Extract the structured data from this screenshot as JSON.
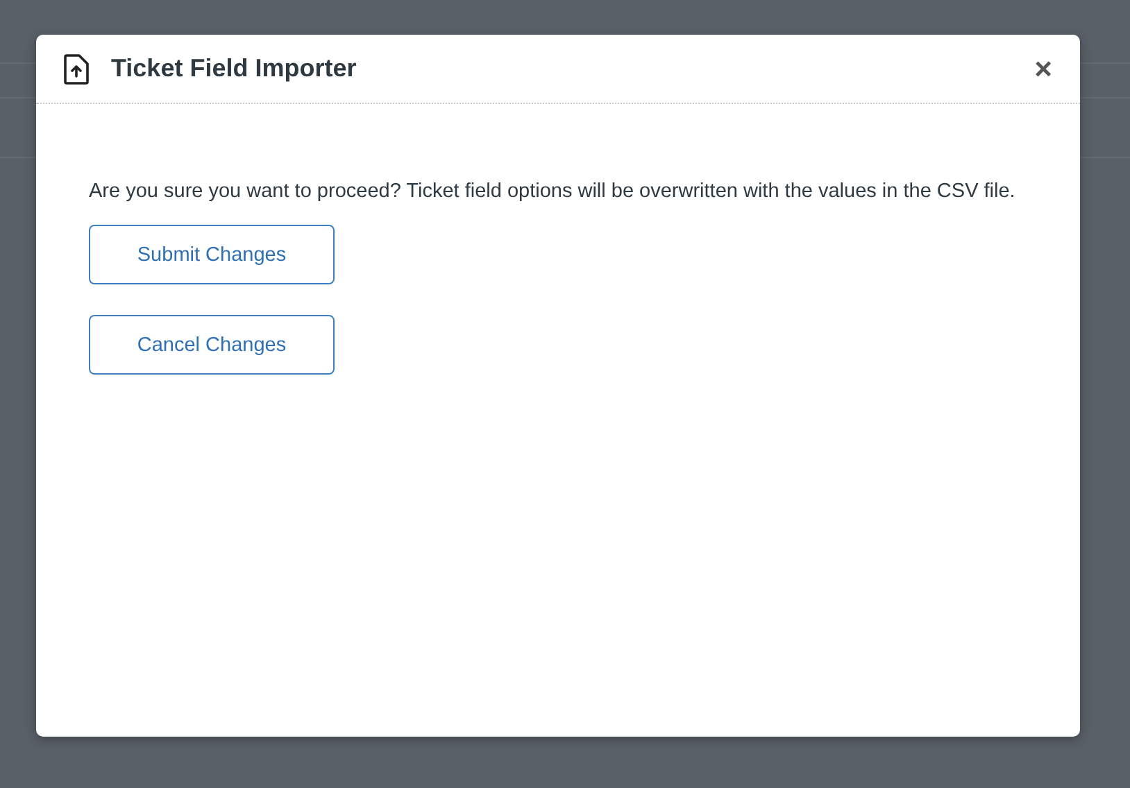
{
  "dialog": {
    "title": "Ticket Field Importer",
    "close": "×",
    "message": "Are you sure you want to proceed? Ticket field options will be overwritten with the values in the CSV file.",
    "buttons": [
      "Submit Changes",
      "Cancel Changes"
    ]
  }
}
